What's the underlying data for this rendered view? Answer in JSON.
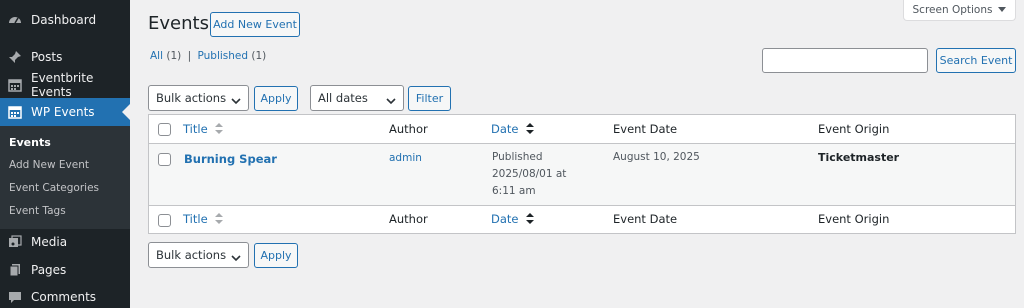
{
  "sidebar": {
    "items": [
      {
        "label": "Dashboard",
        "icon": "dashboard-icon"
      },
      {
        "label": "Posts",
        "icon": "pin-icon"
      },
      {
        "label": "Eventbrite Events",
        "icon": "calendar-icon"
      },
      {
        "label": "WP Events",
        "icon": "calendar-icon"
      },
      {
        "label": "Media",
        "icon": "media-icon"
      },
      {
        "label": "Pages",
        "icon": "pages-icon"
      },
      {
        "label": "Comments",
        "icon": "comment-icon"
      }
    ],
    "submenu": [
      "Events",
      "Add New Event",
      "Event Categories",
      "Event Tags"
    ]
  },
  "header": {
    "title": "Events",
    "add_new": "Add New Event",
    "screen_options": "Screen Options"
  },
  "filters": {
    "all_label": "All",
    "all_count": "(1)",
    "sep": "|",
    "published_label": "Published",
    "published_count": "(1)",
    "search_button": "Search Event",
    "bulk_actions": "Bulk actions",
    "apply": "Apply",
    "all_dates": "All dates",
    "filter": "Filter"
  },
  "table": {
    "columns": [
      "Title",
      "Author",
      "Date",
      "Event Date",
      "Event Origin"
    ],
    "rows": [
      {
        "title": "Burning Spear",
        "author": "admin",
        "date_status": "Published",
        "date_value": "2025/08/01 at 6:11 am",
        "event_date": "August 10, 2025",
        "origin": "Ticketmaster"
      }
    ]
  },
  "colors": {
    "accent": "#2271b1",
    "sidebar_bg": "#1d2327",
    "background": "#f0f0f1"
  }
}
